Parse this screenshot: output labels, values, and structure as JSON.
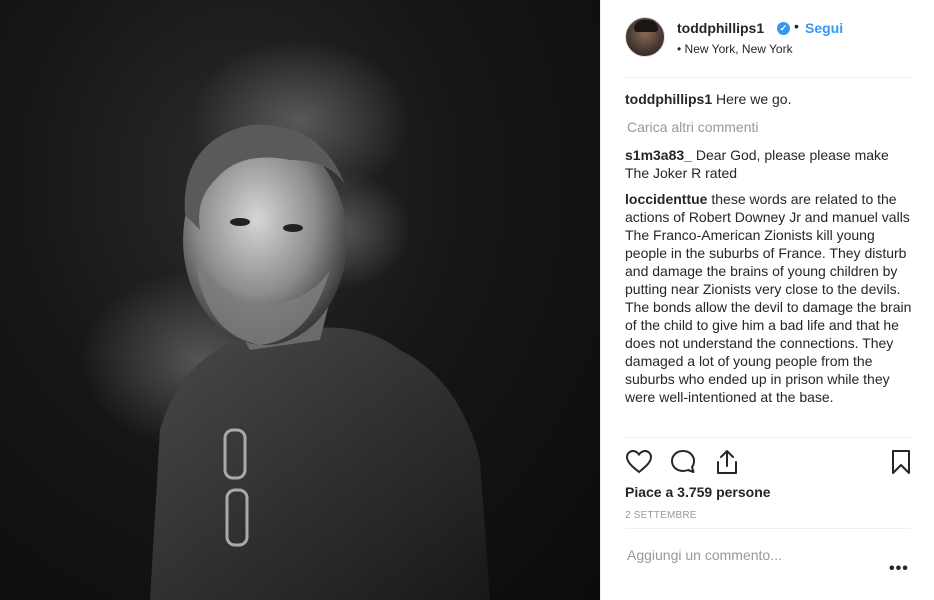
{
  "post": {
    "username": "toddphillips1",
    "verified_icon": "verified-badge-icon",
    "separator": "•",
    "follow_label": "Segui",
    "location_dot": "•",
    "location": "New York, New York"
  },
  "caption": {
    "username": "toddphillips1",
    "text": "Here we go."
  },
  "load_more": "Carica altri commenti",
  "comments": [
    {
      "username": "s1m3a83_",
      "text": "Dear God, please please make The Joker R rated"
    },
    {
      "username": "loccidenttue",
      "text": "these words are related to the actions of Robert Downey Jr and manuel valls",
      "text2": "The Franco-American Zionists kill young people in the suburbs of France. They disturb and damage the brains of young children by putting near Zionists very close to the devils. The bonds allow the devil to damage the brain of the child to give him a bad life and that he does not understand the connections. They damaged a lot of young people from the suburbs who ended up in prison while they were well-intentioned at the base."
    }
  ],
  "actions": {
    "like_icon": "heart-icon",
    "comment_icon": "comment-icon",
    "share_icon": "share-icon",
    "save_icon": "bookmark-icon"
  },
  "likes": "Piace a 3.759 persone",
  "date": "2 SETTEMBRE",
  "add_comment_placeholder": "Aggiungi un commento...",
  "more_options": "•••",
  "colors": {
    "link_blue": "#3897f0",
    "muted": "#999999",
    "text": "#262626"
  }
}
